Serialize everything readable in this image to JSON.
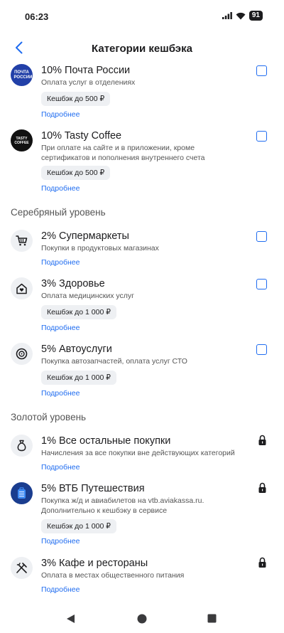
{
  "status": {
    "time": "06:23",
    "battery": "91"
  },
  "header": {
    "title": "Категории кешбэка"
  },
  "more_label": "Подробнее",
  "accent_color": "#1f6cf0",
  "items": [
    {
      "name": "10% Почта России",
      "desc": "Оплата услуг в отделениях",
      "chip": "Кешбэк до 500 ₽",
      "logo": "ПОЧТА РОССИИ",
      "icon": "pochta-logo-icon",
      "control": "checkbox"
    },
    {
      "name": "10% Tasty Coffee",
      "desc": "При оплате на сайте и в приложении, кроме сертификатов и пополнения внутреннего счета",
      "chip": "Кешбэк до 500 ₽",
      "logo": "TASTY COFFEE",
      "icon": "tasty-coffee-logo-icon",
      "control": "checkbox"
    },
    {
      "name": "2% Супермаркеты",
      "desc": "Покупки в продуктовых магазинах",
      "chip": "",
      "icon": "cart-icon",
      "control": "checkbox"
    },
    {
      "name": "3% Здоровье",
      "desc": "Оплата медицинских услуг",
      "chip": "Кешбэк до 1 000 ₽",
      "icon": "health-icon",
      "control": "checkbox"
    },
    {
      "name": "5% Автоуслуги",
      "desc": "Покупка автозапчастей, оплата услуг СТО",
      "chip": "Кешбэк до 1 000 ₽",
      "icon": "wheel-icon",
      "control": "checkbox"
    },
    {
      "name": "1% Все остальные покупки",
      "desc": "Начисления за все покупки вне действующих категорий",
      "chip": "",
      "icon": "money-bag-icon",
      "control": "lock"
    },
    {
      "name": "5% ВТБ Путешествия",
      "desc": "Покупка ж/д и авиабилетов на vtb.aviakassa.ru. Дополнительно к кешбэку в сервисе",
      "chip": "Кешбэк до 1 000 ₽",
      "icon": "suitcase-icon",
      "control": "lock"
    },
    {
      "name": "3% Кафе и рестораны",
      "desc": "Оплата в местах общественного питания",
      "chip": "",
      "icon": "cutlery-icon",
      "control": "lock"
    }
  ],
  "sections": {
    "silver": "Серебряный уровень",
    "gold": "Золотой уровень"
  }
}
